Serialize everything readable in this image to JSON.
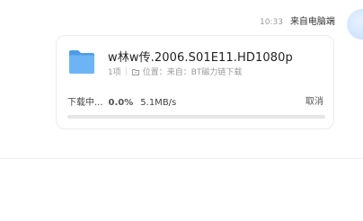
{
  "message": {
    "time": "10:33",
    "sender": "来自电脑端"
  },
  "file_card": {
    "name": "w林w传.2006.S01E11.HD1080p",
    "count": "1项",
    "location_label": "位置：来自：BT磁力链下载",
    "status": "下载中...",
    "progress_percent": "0.0%",
    "progress_fraction": 0.0,
    "speed": "5.1MB/s",
    "cancel_label": "取消"
  },
  "colors": {
    "accent": "#2f7cf6",
    "folder": "#5aa7f0"
  },
  "icons": {
    "folder": "folder-icon",
    "location": "location-icon",
    "avatar": "avatar"
  }
}
